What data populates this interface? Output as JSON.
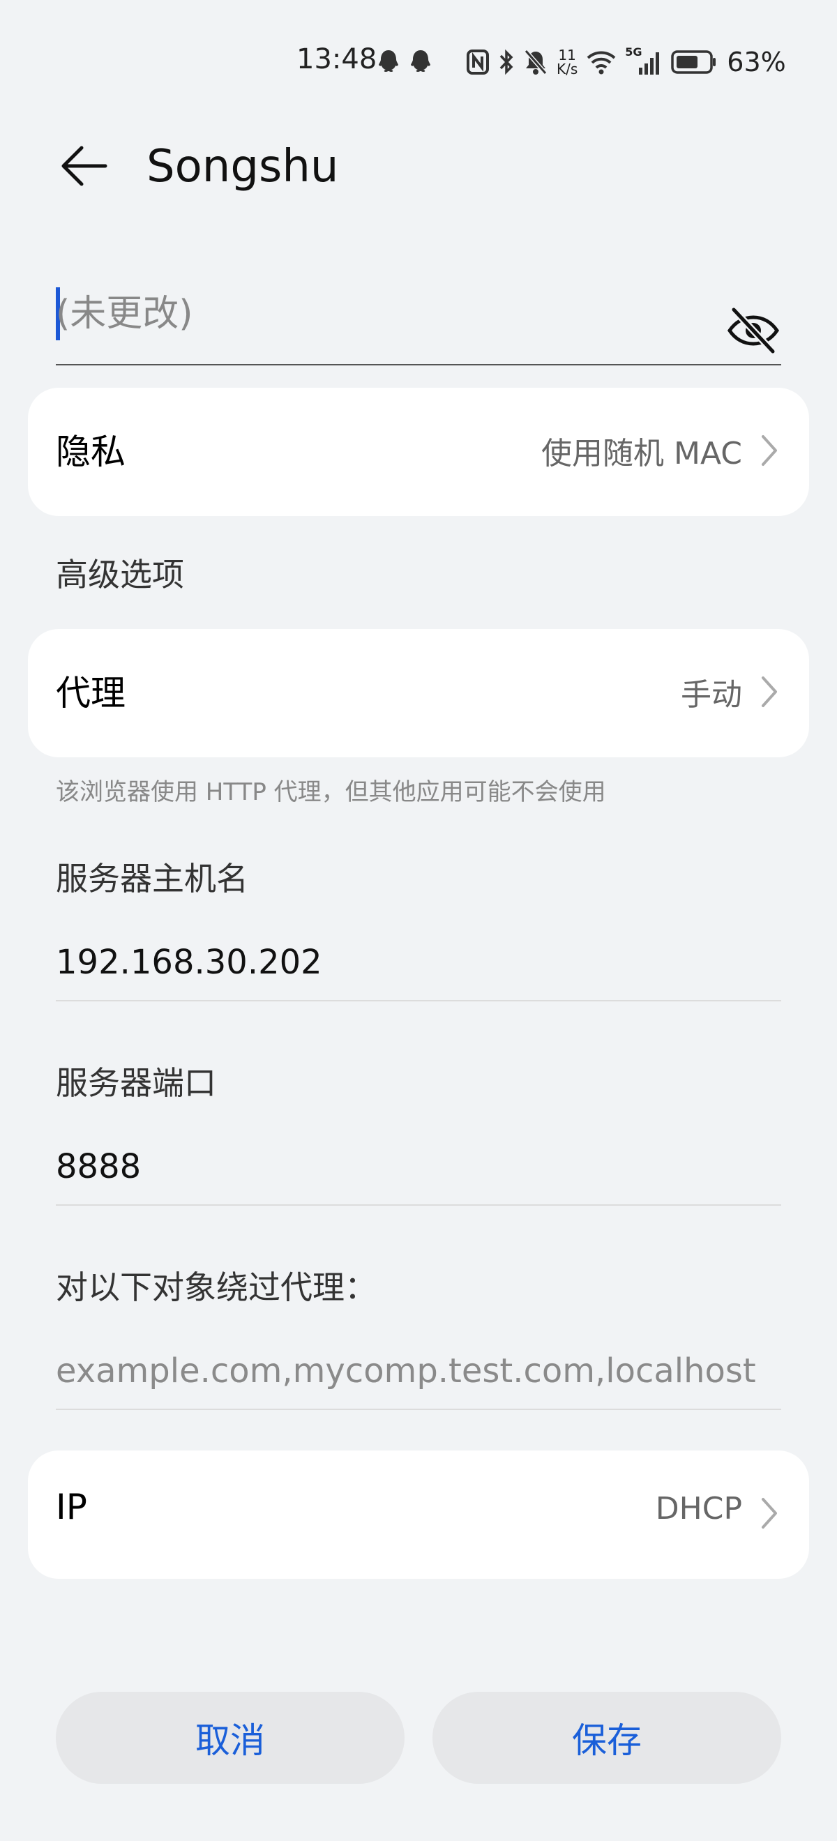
{
  "status_bar": {
    "time": "13:48",
    "net_speed_value": "11",
    "net_speed_unit": "K/s",
    "signal_label": "5G",
    "battery_percent": "63%"
  },
  "header": {
    "title": "Songshu"
  },
  "password": {
    "placeholder": "(未更改)"
  },
  "privacy": {
    "label": "隐私",
    "value": "使用随机 MAC"
  },
  "advanced": {
    "title": "高级选项"
  },
  "proxy": {
    "label": "代理",
    "value": "手动",
    "hint": "该浏览器使用 HTTP 代理，但其他应用可能不会使用"
  },
  "server_host": {
    "label": "服务器主机名",
    "value": "192.168.30.202"
  },
  "server_port": {
    "label": "服务器端口",
    "value": "8888"
  },
  "bypass": {
    "label": "对以下对象绕过代理：",
    "placeholder": "example.com,mycomp.test.com,localhost"
  },
  "ip": {
    "label": "IP",
    "value": "DHCP"
  },
  "actions": {
    "cancel": "取消",
    "save": "保存"
  },
  "colors": {
    "accent": "#1a5fd9",
    "background": "#f1f3f5",
    "card": "#ffffff"
  }
}
